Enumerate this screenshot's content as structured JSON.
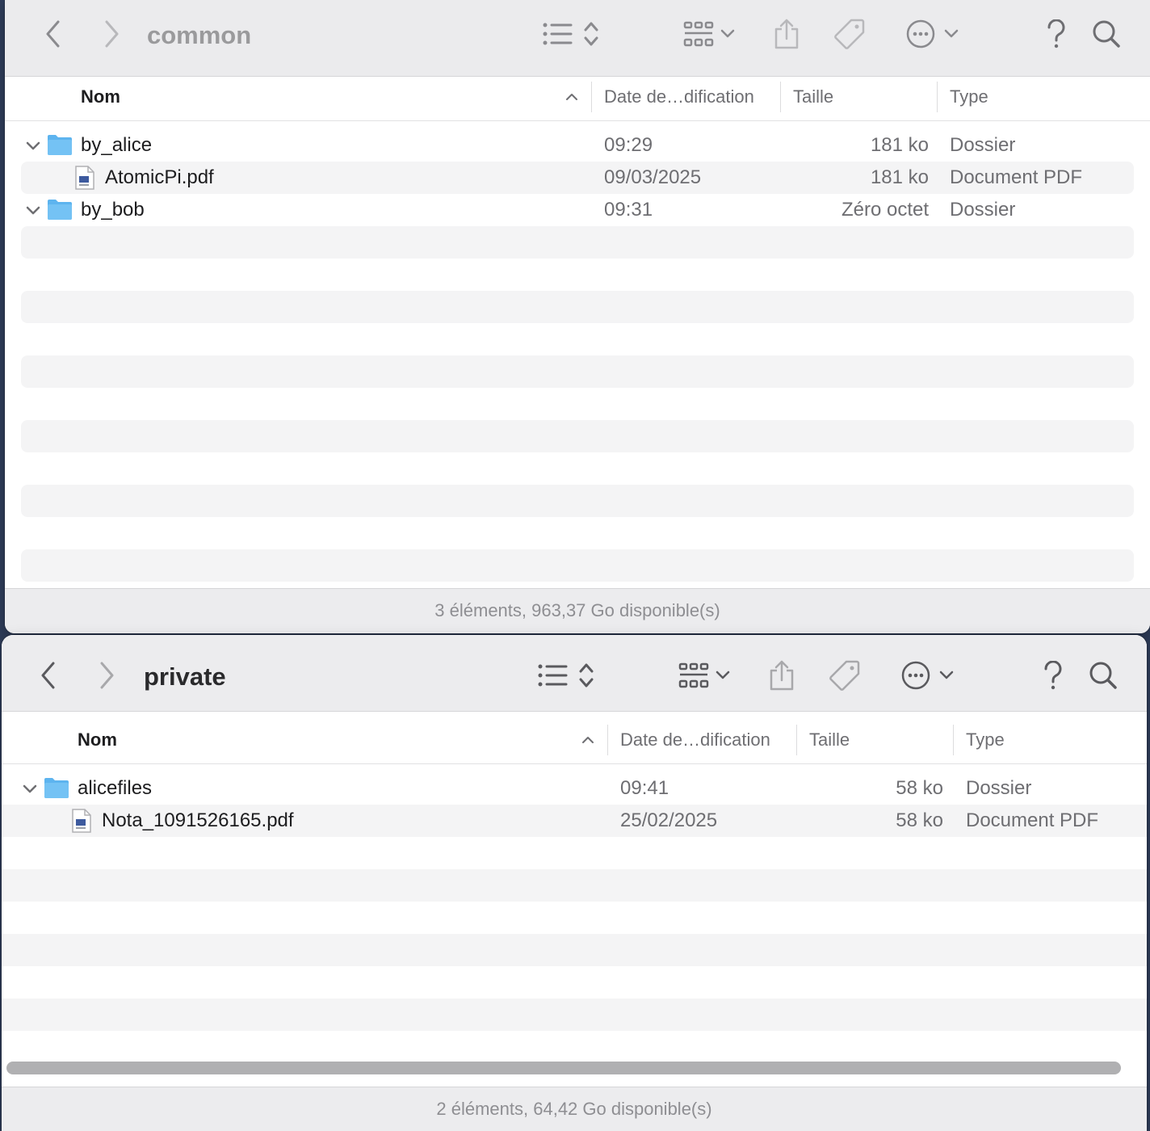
{
  "windows": {
    "common": {
      "title": "common",
      "columns": {
        "name": "Nom",
        "date": "Date de…dification",
        "size": "Taille",
        "type": "Type"
      },
      "rows": [
        {
          "name": "by_alice",
          "date": "09:29",
          "size": "181 ko",
          "type": "Dossier",
          "kind": "folder",
          "expanded": true
        },
        {
          "name": "AtomicPi.pdf",
          "date": "09/03/2025",
          "size": "181 ko",
          "type": "Document PDF",
          "kind": "pdf"
        },
        {
          "name": "by_bob",
          "date": "09:31",
          "size": "Zéro octet",
          "type": "Dossier",
          "kind": "folder",
          "expanded": true
        }
      ],
      "status": "3 éléments, 963,37 Go disponible(s)"
    },
    "private": {
      "title": "private",
      "columns": {
        "name": "Nom",
        "date": "Date de…dification",
        "size": "Taille",
        "type": "Type"
      },
      "rows": [
        {
          "name": "alicefiles",
          "date": "09:41",
          "size": "58 ko",
          "type": "Dossier",
          "kind": "folder",
          "expanded": true
        },
        {
          "name": "Nota_1091526165.pdf",
          "date": "25/02/2025",
          "size": "58 ko",
          "type": "Document PDF",
          "kind": "pdf"
        }
      ],
      "status": "2 éléments, 64,42 Go disponible(s)"
    }
  },
  "toolbar_icons": [
    "back-chevron-icon",
    "forward-chevron-icon",
    "list-view-icon",
    "sort-updown-icon",
    "grid-group-icon",
    "share-icon",
    "tag-icon",
    "more-ellipsis-icon",
    "help-icon",
    "search-icon"
  ],
  "colors": {
    "folder": "#5db4ef",
    "selection_stripe": "#f4f4f5",
    "toolbar_bg": "#ececee"
  }
}
